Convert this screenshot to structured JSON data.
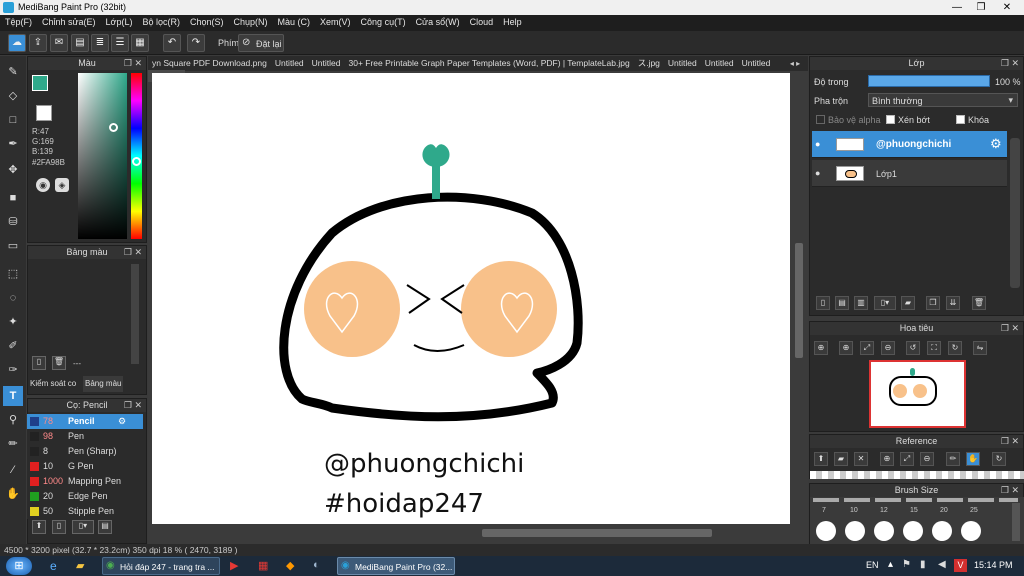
{
  "window": {
    "title": "MediBang Paint Pro (32bit)"
  },
  "menu": [
    "Tệp(F)",
    "Chỉnh sửa(E)",
    "Lớp(L)",
    "Bộ lọc(R)",
    "Chọn(S)",
    "Chụp(N)",
    "Màu (C)",
    "Xem(V)",
    "Công cụ(T)",
    "Cửa sổ(W)",
    "Cloud",
    "Help"
  ],
  "toolbar": {
    "label": "Phím",
    "reset": "Đặt lại"
  },
  "color_panel": {
    "title": "Màu",
    "r": "R:47",
    "g": "G:169",
    "b": "B:139",
    "hex": "#2FA98B",
    "accent": "#2FA98B"
  },
  "palette_panel": {
    "title": "Bảng màu",
    "input": "---",
    "tab1": "Kiểm soát co",
    "tab2": "Bảng màu"
  },
  "brush_panel": {
    "title": "Cọ: Pencil",
    "brushes": [
      {
        "size": "78",
        "name": "Pencil",
        "color": "#1f3f8a"
      },
      {
        "size": "98",
        "name": "Pen",
        "color": "#222222"
      },
      {
        "size": "8",
        "name": "Pen (Sharp)",
        "color": "#222222"
      },
      {
        "size": "10",
        "name": "G Pen",
        "color": "#e02020"
      },
      {
        "size": "1000",
        "name": "Mapping Pen",
        "color": "#e02020"
      },
      {
        "size": "20",
        "name": "Edge Pen",
        "color": "#20a020"
      },
      {
        "size": "50",
        "name": "Stipple Pen",
        "color": "#e0d020"
      }
    ]
  },
  "tabs": [
    "yn Square PDF Download.png",
    "Untitled",
    "Untitled",
    "30+ Free Printable Graph Paper Templates (Word, PDF) | TemplateLab.jpg",
    "ス.jpg",
    "Untitled",
    "Untitled",
    "Untitled",
    "Untitled"
  ],
  "canvas": {
    "caption1": "@phuongchichi",
    "caption2": "#hoidap247"
  },
  "layer_panel": {
    "title": "Lớp",
    "opacity_label": "Độ trong",
    "opacity_value": "100 %",
    "blend_label": "Pha trộn",
    "blend_value": "Bình thường",
    "protect_alpha": "Bảo vệ alpha",
    "clipping": "Xén bớt",
    "lock": "Khóa",
    "layers": [
      {
        "name": "@phuongchichi",
        "selected": true
      },
      {
        "name": "Lớp1",
        "selected": false
      }
    ]
  },
  "navigator": {
    "title": "Hoa tiêu"
  },
  "reference": {
    "title": "Reference"
  },
  "brush_size": {
    "title": "Brush Size",
    "sizes": [
      "7",
      "10",
      "12",
      "15",
      "20",
      "25"
    ]
  },
  "status": {
    "text": "4500 * 3200 pixel  (32.7 * 23.2cm)  350 dpi  18 %  ( 2470, 3189 )"
  },
  "taskbar": {
    "task1": "Hỏi đáp 247 - trang tra ...",
    "task2": "MediBang Paint Pro (32...",
    "lang": "EN",
    "time": "15:14 PM"
  }
}
